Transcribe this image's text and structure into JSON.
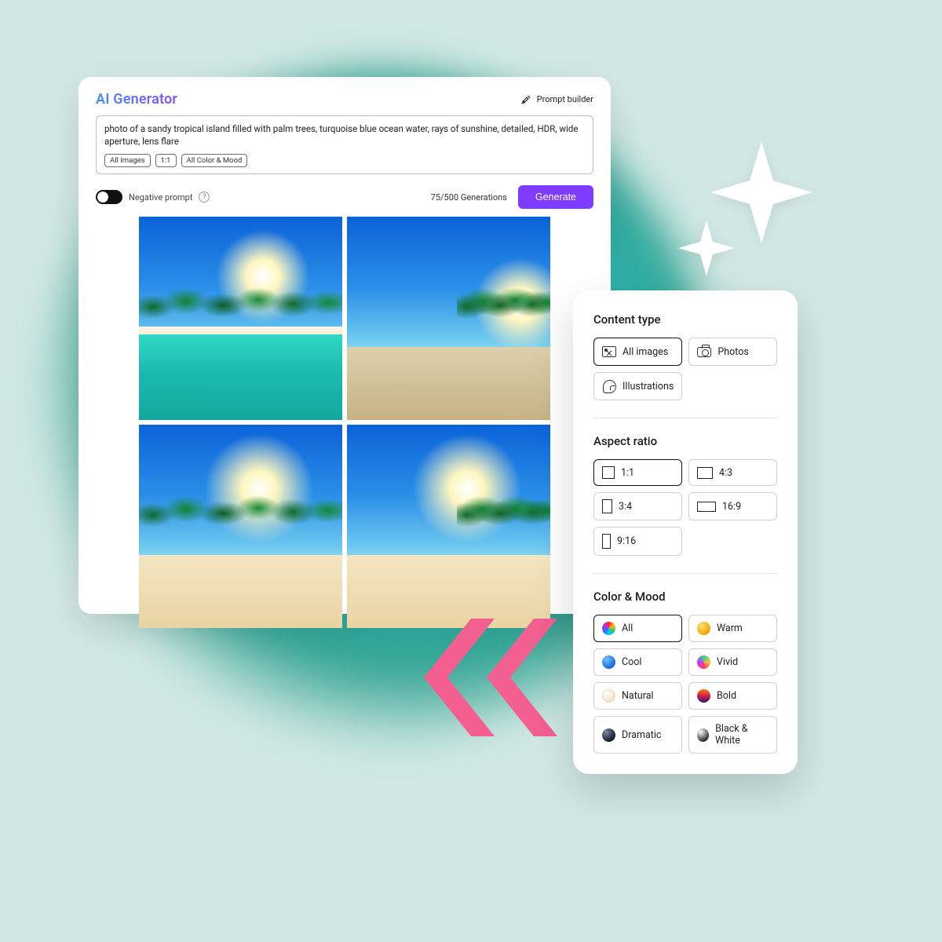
{
  "generator": {
    "title": "AI Generator",
    "prompt_builder_label": "Prompt builder",
    "prompt_text": "photo of a sandy tropical island filled with palm trees, turquoise blue ocean water, rays of sunshine, detailed, HDR, wide aperture, lens flare",
    "chips": {
      "images": "All Images",
      "ratio": "1:1",
      "mood": "All Color & Mood"
    },
    "negative_prompt_label": "Negative prompt",
    "generations_label": "75/500 Generations",
    "generate_label": "Generate"
  },
  "options": {
    "content_type": {
      "title": "Content type",
      "all_images": "All images",
      "photos": "Photos",
      "illustrations": "Illustrations"
    },
    "aspect_ratio": {
      "title": "Aspect ratio",
      "r11": "1:1",
      "r43": "4:3",
      "r34": "3:4",
      "r169": "16:9",
      "r916": "9:16"
    },
    "color_mood": {
      "title": "Color & Mood",
      "all": "All",
      "warm": "Warm",
      "cool": "Cool",
      "vivid": "Vivid",
      "natural": "Natural",
      "bold": "Bold",
      "dramatic": "Dramatic",
      "bw": "Black & White"
    }
  }
}
